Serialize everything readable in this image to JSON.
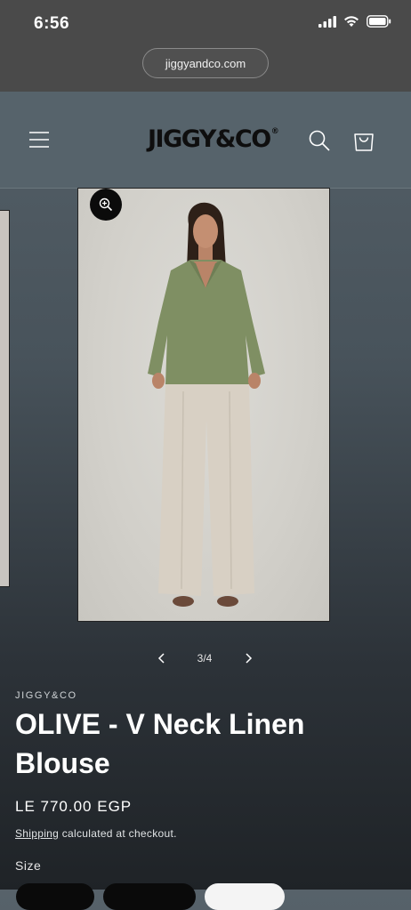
{
  "status_bar": {
    "time": "6:56"
  },
  "browser": {
    "url": "jiggyandco.com"
  },
  "header": {
    "logo": "JIGGY&CO",
    "logo_mark": "®"
  },
  "gallery": {
    "counter": "3/4"
  },
  "product": {
    "vendor": "JIGGY&CO",
    "title": "OLIVE - V Neck Linen Blouse",
    "price": "LE 770.00 EGP",
    "shipping_link": "Shipping",
    "shipping_text": " calculated at checkout.",
    "size_label": "Size"
  },
  "colors": {
    "background": "#48535b",
    "header": "#56636b",
    "status": "#4a4a4a",
    "blouse": "#7f8f63",
    "trousers": "#d8d0c4"
  }
}
